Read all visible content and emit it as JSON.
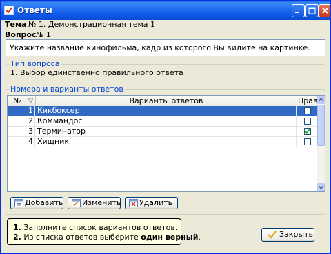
{
  "window": {
    "title": "Ответы",
    "controls": {
      "minimize": "minimize-icon",
      "maximize": "maximize-icon",
      "close": "close-icon"
    }
  },
  "topic": {
    "label": "Тема",
    "value": "№ 1. Демонстрационная тема 1"
  },
  "question": {
    "label": "Вопрос",
    "value": "№ 1",
    "text": "Укажите название кинофильма, кадр из которого Вы видите на картинке."
  },
  "question_type": {
    "group_title": "Тип вопроса",
    "value": "1. Выбор единственно правильного ответа"
  },
  "answers": {
    "group_title": "Номера и варианты ответов",
    "columns": {
      "num": "№",
      "text": "Варианты ответов",
      "correct": "Прави"
    },
    "rows": [
      {
        "num": "1",
        "text": "Кикбоксер",
        "correct": false,
        "selected": true
      },
      {
        "num": "2",
        "text": "Коммандос",
        "correct": false,
        "selected": false
      },
      {
        "num": "3",
        "text": "Терминатор",
        "correct": true,
        "selected": false
      },
      {
        "num": "4",
        "text": "Хищник",
        "correct": false,
        "selected": false
      }
    ]
  },
  "buttons": {
    "add": "Добавить",
    "edit": "Изменить",
    "delete": "Удалить",
    "close": "Закрыть"
  },
  "hint": {
    "line1_num": "1.",
    "line1_text": "Заполните список вариантов ответов.",
    "line2_num": "2.",
    "line2_text": "Из списка ответов выберите",
    "line2_bold": "один верный",
    "line2_end": "."
  },
  "colors": {
    "title_bar": "#0a5ee8",
    "selection": "#316ac5",
    "group_title": "#0046d5",
    "hint_bg": "#ffffe1"
  }
}
